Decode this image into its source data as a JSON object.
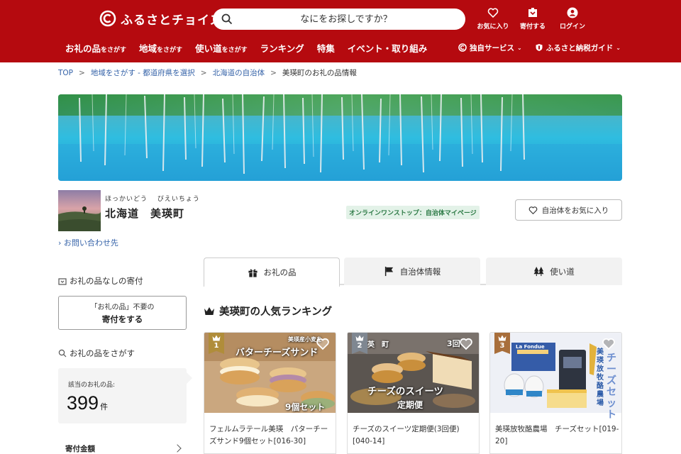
{
  "header": {
    "logo_text": "ふるさとチョイス",
    "search_placeholder": "なにをお探しですか？",
    "icons": {
      "favorites": "お気に入り",
      "donate": "寄付する",
      "login": "ログイン"
    },
    "nav": [
      {
        "main": "お礼の品",
        "sub": "をさがす"
      },
      {
        "main": "地域",
        "sub": "をさがす"
      },
      {
        "main": "使い道",
        "sub": "をさがす"
      },
      {
        "main": "ランキング",
        "sub": ""
      },
      {
        "main": "特集",
        "sub": ""
      },
      {
        "main": "イベント・取り組み",
        "sub": ""
      }
    ],
    "nav_right": {
      "services": "独自サービス",
      "guide": "ふるさと納税ガイド"
    }
  },
  "breadcrumb": {
    "top": "TOP",
    "region": "地域をさがす - 都道府県を選択",
    "pref": "北海道の自治体",
    "current": "美瑛町のお礼の品情報"
  },
  "municipality": {
    "ruby": "ほっかいどう　 びえいちょう",
    "name": "北海道　美瑛町",
    "onestop": "オンラインワンストップ：自治体マイページ",
    "favorite_button": "自治体をお気に入り",
    "contact": "お問い合わせ先"
  },
  "sidebar": {
    "nogift_heading": "お礼の品なしの寄付",
    "nogift_line1": "「お礼の品」不要の",
    "nogift_line2": "寄付をする",
    "search_heading": "お礼の品をさがす",
    "count_label": "該当のお礼の品:",
    "count_value": "399",
    "count_unit": "件",
    "amount_label": "寄付金額"
  },
  "tabs": {
    "gifts": "お礼の品",
    "info": "自治体情報",
    "usage": "使い道"
  },
  "ranking": {
    "title": "美瑛町の人気ランキング",
    "items": [
      {
        "rank": "1",
        "title": "フェルムラテール美瑛　パターチーズサンド9個セット[016-30]",
        "overlay_main": "バターチーズサンド",
        "overlay_sub": "9個セット",
        "overlay_tag": "美瑛産小麦を"
      },
      {
        "rank": "2",
        "title": "チーズのスイーツ定期便(3回便)[040-14]",
        "overlay_main": "チーズのスイーツ",
        "overlay_sub": "定期便",
        "overlay_tag": "英　町",
        "overlay_count": "3回"
      },
      {
        "rank": "3",
        "title": "美瑛放牧酪農場　チーズセット[019-20]",
        "overlay_main": "チーズセット",
        "overlay_sub": "美瑛放牧酪農場",
        "overlay_tag": "La Fondue"
      }
    ]
  },
  "colors": {
    "brand_red": "#b50a0f",
    "link_blue": "#3462a8",
    "gold": "#b08d3a"
  }
}
